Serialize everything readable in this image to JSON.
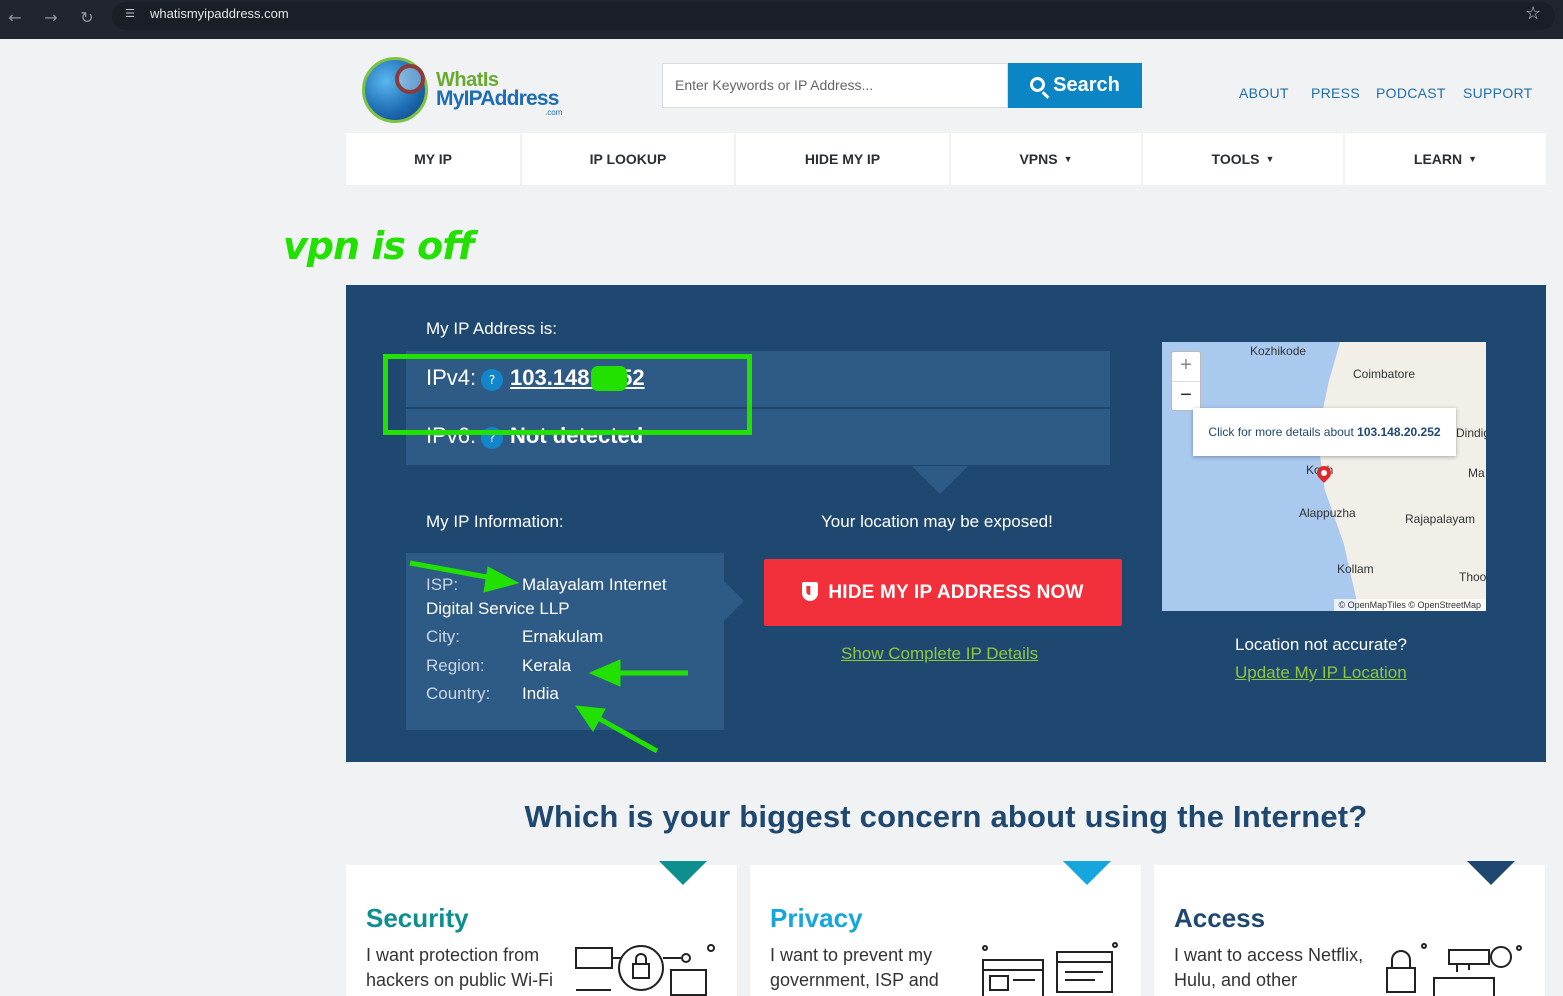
{
  "browser": {
    "url": "whatismyipaddress.com",
    "back_icon": "arrow-left-icon",
    "forward_icon": "arrow-right-icon",
    "reload_icon": "reload-icon",
    "site_info_icon": "tune-icon",
    "bookmark_icon": "star-icon"
  },
  "header": {
    "logo_line1": "WhatIs",
    "logo_line2": "MyIPAddress",
    "logo_suffix": ".com",
    "search_placeholder": "Enter Keywords or IP Address...",
    "search_button": "Search",
    "top_links": [
      "ABOUT",
      "PRESS",
      "PODCAST",
      "SUPPORT"
    ]
  },
  "nav": [
    {
      "label": "MY IP",
      "dropdown": false
    },
    {
      "label": "IP LOOKUP",
      "dropdown": false
    },
    {
      "label": "HIDE MY IP",
      "dropdown": false
    },
    {
      "label": "VPNS",
      "dropdown": true
    },
    {
      "label": "TOOLS",
      "dropdown": true
    },
    {
      "label": "LEARN",
      "dropdown": true
    }
  ],
  "annotation": {
    "note": "vpn is off",
    "color": "#22e000"
  },
  "ip_panel": {
    "heading": "My IP Address is:",
    "ipv4_label": "IPv4:",
    "ipv4_value": "103.148.   .252",
    "ipv6_label": "IPv6:",
    "ipv6_value": "Not detected",
    "help_icon": "question-icon",
    "info_heading": "My IP Information:",
    "info": {
      "isp_label": "ISP:",
      "isp_value_line1": "Malayalam Internet",
      "isp_value_line2": "Digital Service LLP",
      "city_label": "City:",
      "city_value": "Ernakulam",
      "region_label": "Region:",
      "region_value": "Kerala",
      "country_label": "Country:",
      "country_value": "India"
    },
    "exposed_text": "Your location may be exposed!",
    "hide_button": "HIDE MY IP ADDRESS NOW",
    "details_link": "Show Complete IP Details",
    "location_question": "Location not accurate?",
    "update_link": "Update My IP Location",
    "map": {
      "zoom_in": "+",
      "zoom_out": "−",
      "popup_prefix": "Click for more details about",
      "popup_ip": "103.148.20.252",
      "cities": [
        "Kozhikode",
        "Coimbatore",
        "Dindig",
        "Ma",
        "Koch",
        "Alappuzha",
        "Rajapalayam",
        "Kollam",
        "Thoo"
      ],
      "attribution": "© OpenMapTiles © OpenStreetMap"
    }
  },
  "concern": {
    "title": "Which is your biggest concern about using the Internet?",
    "cards": [
      {
        "title": "Security",
        "text": "I want protection from hackers on public Wi-Fi",
        "color": "#0d8f8f"
      },
      {
        "title": "Privacy",
        "text": "I want to prevent my government, ISP and",
        "color": "#16a6de"
      },
      {
        "title": "Access",
        "text": "I want to access Netflix, Hulu, and other",
        "color": "#1f4870"
      }
    ]
  }
}
